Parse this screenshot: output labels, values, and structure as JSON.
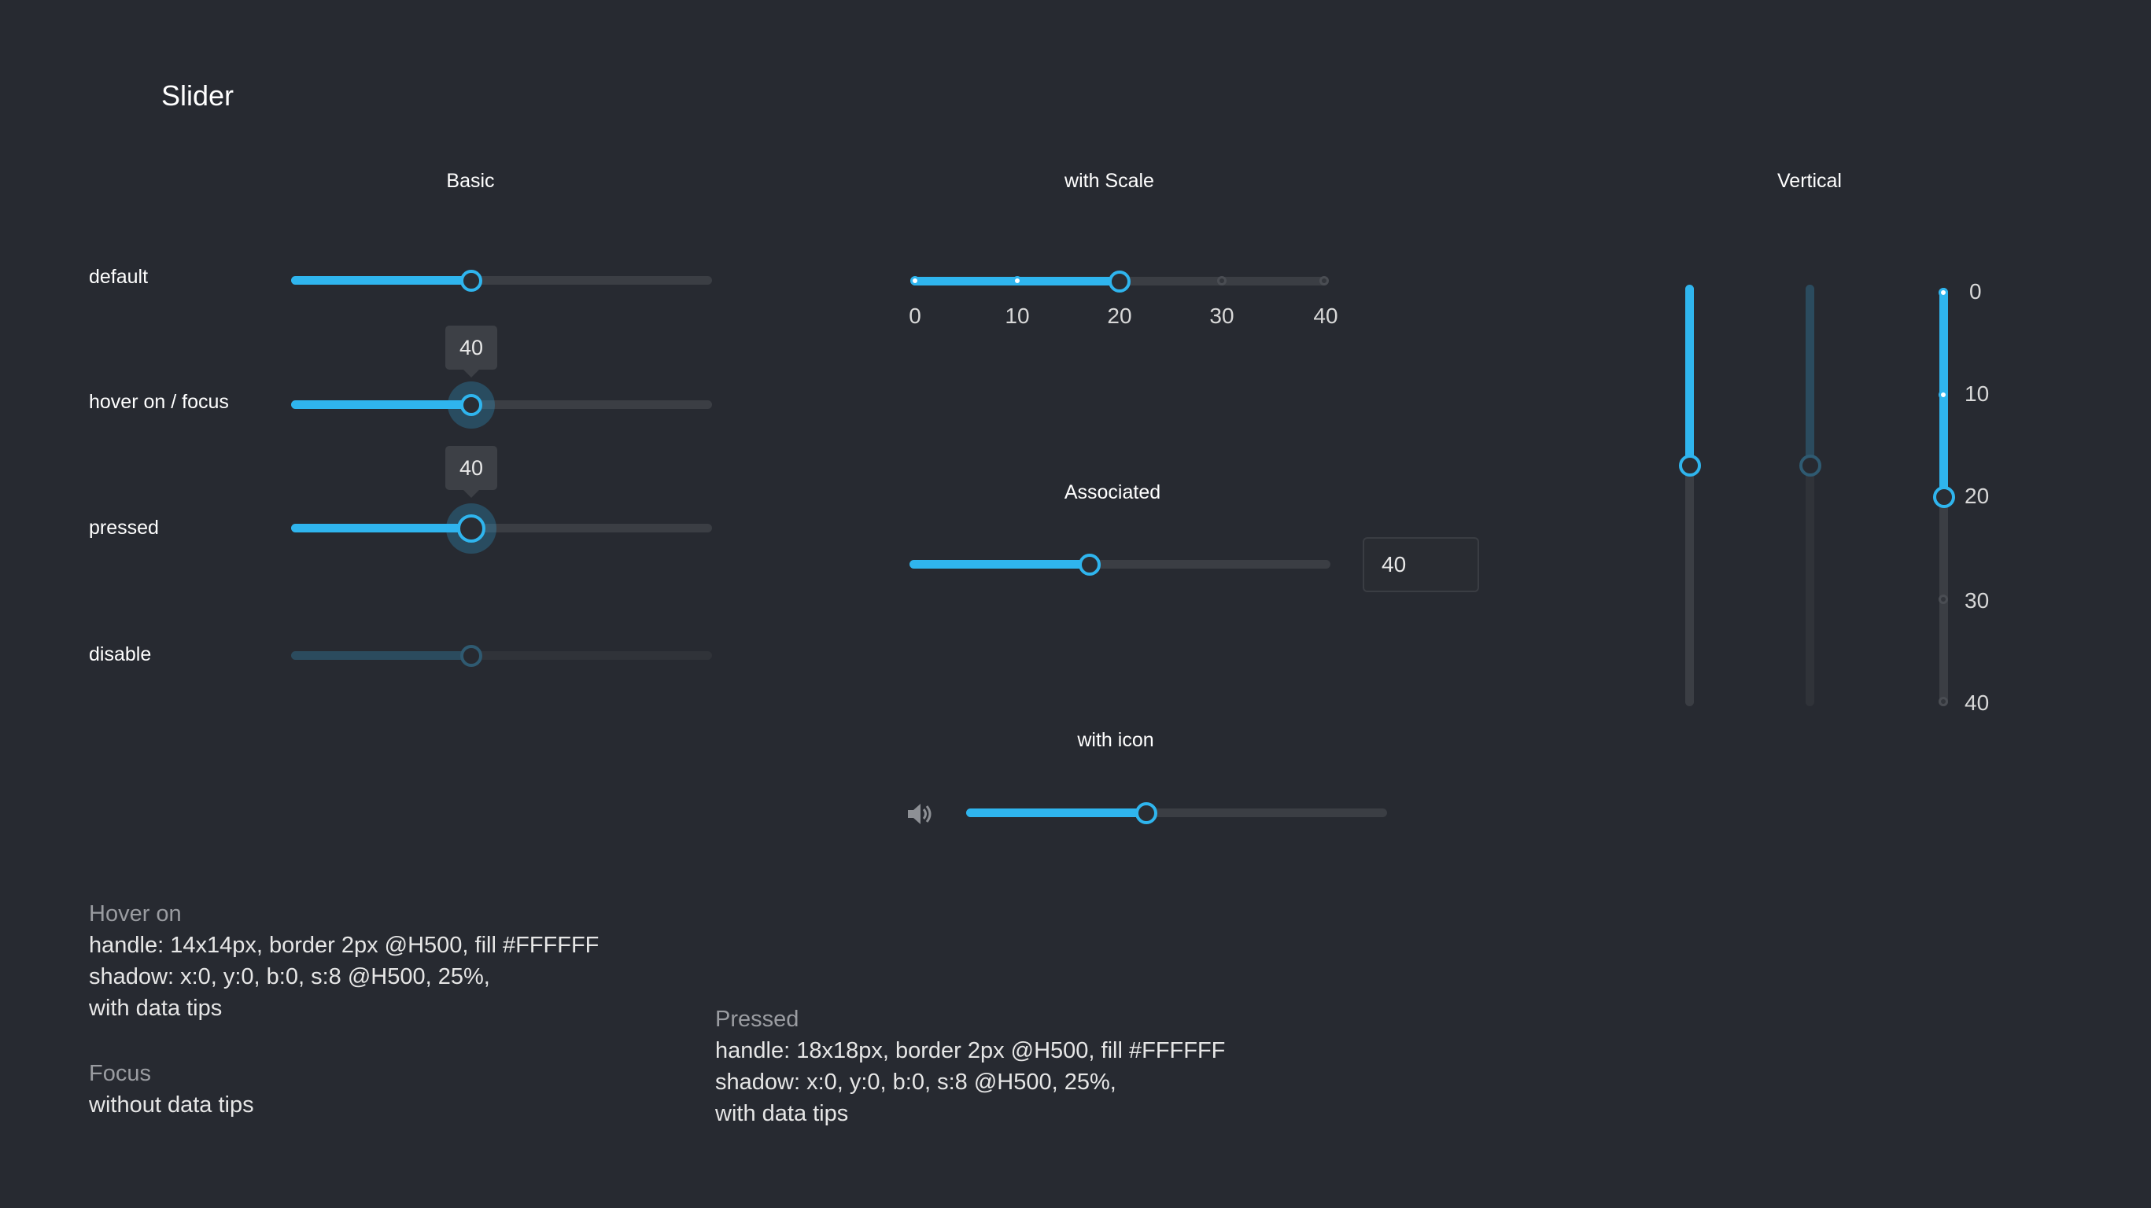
{
  "page_title": "Slider",
  "basic": {
    "title": "Basic",
    "value": 40,
    "rows": [
      {
        "label": "default"
      },
      {
        "label": "hover on / focus",
        "tip": "40"
      },
      {
        "label": "pressed",
        "tip": "40"
      },
      {
        "label": "disable"
      }
    ]
  },
  "scale": {
    "title": "with Scale",
    "value": 20,
    "ticks": [
      "0",
      "10",
      "20",
      "30",
      "40"
    ]
  },
  "associated": {
    "title": "Associated",
    "value": 40,
    "input_value": "40"
  },
  "with_icon": {
    "title": "with icon",
    "icon": "speaker-icon",
    "value": 40
  },
  "vertical": {
    "title": "Vertical",
    "value_fraction": 0.43,
    "scale_value": 20,
    "ticks": [
      "0",
      "10",
      "20",
      "30",
      "40"
    ]
  },
  "notes": {
    "hover_heading": "Hover on",
    "hover_line1": "handle: 14x14px, border 2px @H500, fill #FFFFFF",
    "hover_line2": "shadow: x:0, y:0, b:0, s:8  @H500, 25%,",
    "hover_line3": "with data tips",
    "focus_heading": "Focus",
    "focus_line1": "without data tips",
    "pressed_heading": "Pressed",
    "pressed_line1": "handle: 18x18px, border 2px @H500, fill #FFFFFF",
    "pressed_line2": "shadow: x:0, y:0, b:0, s:8  @H500, 25%,",
    "pressed_line3": "with data tips"
  },
  "colors": {
    "background": "#272a31",
    "accent": "#2fb5ee",
    "track": "#3b3e44"
  }
}
